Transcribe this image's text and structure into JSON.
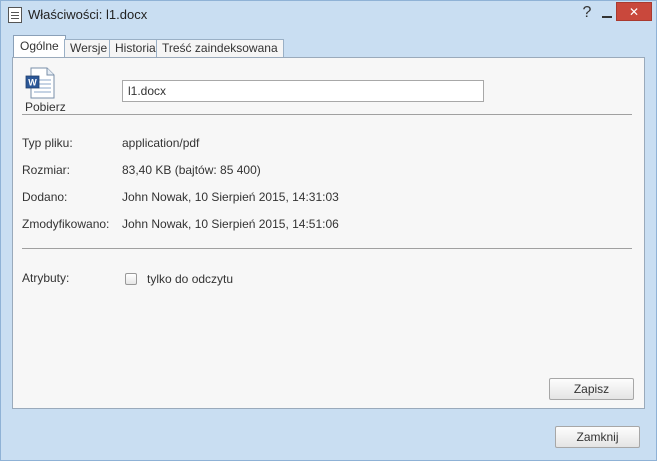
{
  "window": {
    "title": "Właściwości: l1.docx",
    "help_label": "?",
    "close_label": "✕"
  },
  "tabs": [
    {
      "label": "Ogólne",
      "active": true
    },
    {
      "label": "Wersje",
      "active": false
    },
    {
      "label": "Historia",
      "active": false
    },
    {
      "label": "Treść zaindeksowana",
      "active": false
    }
  ],
  "general": {
    "download_label": "Pobierz",
    "file_name_value": "l1.docx",
    "file_type_label": "Typ pliku:",
    "file_type_value": "application/pdf",
    "size_label": "Rozmiar:",
    "size_value": "83,40 KB (bajtów: 85 400)",
    "added_label": "Dodano:",
    "added_value": "John Nowak, 10 Sierpień 2015, 14:31:03",
    "modified_label": "Zmodyfikowano:",
    "modified_value": "John Nowak, 10 Sierpień 2015, 14:51:06",
    "attributes_label": "Atrybuty:",
    "readonly_label": "tylko do odczytu",
    "readonly_checked": false,
    "save_label": "Zapisz"
  },
  "footer": {
    "close_label": "Zamknij"
  },
  "icons": {
    "window": "document-icon",
    "file": "word-document-icon"
  },
  "colors": {
    "window_bg": "#c9def2",
    "close_button": "#c9483c"
  }
}
